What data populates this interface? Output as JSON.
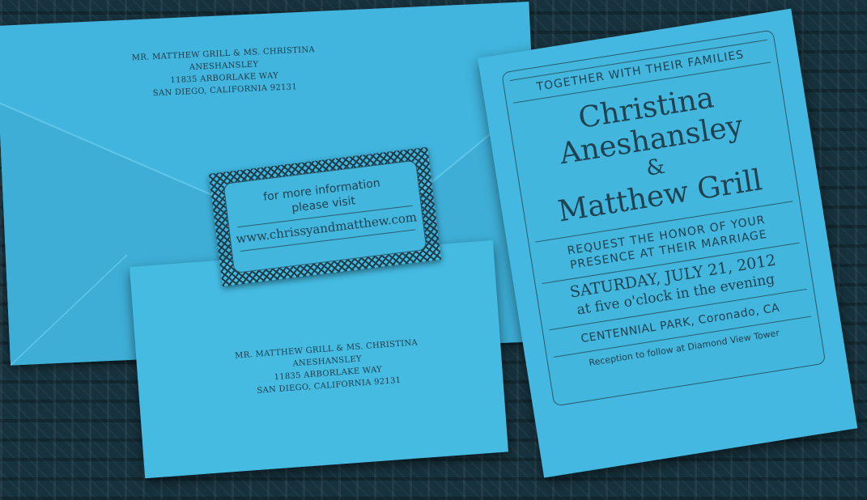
{
  "envelope_back": {
    "address": [
      "MR. MATTHEW GRILL & MS. CHRISTINA ANESHANSLEY",
      "11835 ARBORLAKE WAY",
      "SAN DIEGO, CALIFORNIA 92131"
    ]
  },
  "envelope_front": {
    "address": [
      "MR. MATTHEW GRILL & MS. CHRISTINA ANESHANSLEY",
      "11835 ARBORLAKE WAY",
      "SAN DIEGO, CALIFORNIA 92131"
    ]
  },
  "info_card": {
    "line1": "for more information",
    "line2": "please visit",
    "url": "www.chrissyandmatthew.com"
  },
  "invitation": {
    "header": "TOGETHER WITH THEIR FAMILIES",
    "name1_first": "Christina",
    "name1_last": "Aneshansley",
    "ampersand": "&",
    "name2": "Matthew Grill",
    "request1": "REQUEST THE HONOR OF YOUR",
    "request2": "PRESENCE AT THEIR MARRIAGE",
    "date": "SATURDAY, JULY 21, 2012",
    "time": "at five o'clock in the evening",
    "venue": "CENTENNIAL PARK, Coronado, CA",
    "reception": "Reception to follow at Diamond View Tower"
  },
  "colors": {
    "background": "#17323d",
    "paper": "#44b8e0",
    "ink": "#1e3b48"
  }
}
